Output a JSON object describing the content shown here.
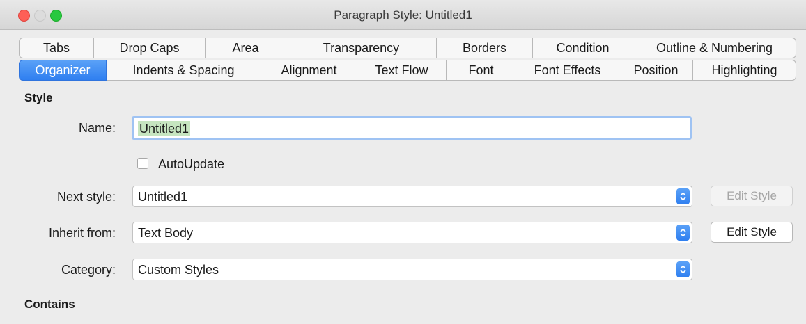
{
  "window": {
    "title": "Paragraph Style: Untitled1"
  },
  "tabs_row1": [
    "Tabs",
    "Drop Caps",
    "Area",
    "Transparency",
    "Borders",
    "Condition",
    "Outline & Numbering"
  ],
  "tabs_row2": [
    "Organizer",
    "Indents & Spacing",
    "Alignment",
    "Text Flow",
    "Font",
    "Font Effects",
    "Position",
    "Highlighting"
  ],
  "active_tab": "Organizer",
  "style_section": {
    "title": "Style",
    "name_label": "Name:",
    "name_value": "Untitled1",
    "autoupdate_label": "AutoUpdate",
    "autoupdate_checked": false,
    "next_style_label": "Next style:",
    "next_style_value": "Untitled1",
    "inherit_label": "Inherit from:",
    "inherit_value": "Text Body",
    "category_label": "Category:",
    "category_value": "Custom Styles",
    "edit_style_label": "Edit Style"
  },
  "contains_section": {
    "title": "Contains"
  },
  "colors": {
    "accent": "#2f7ff0",
    "selection": "#c6e5c0",
    "focus_ring": "#9fc3f3"
  }
}
